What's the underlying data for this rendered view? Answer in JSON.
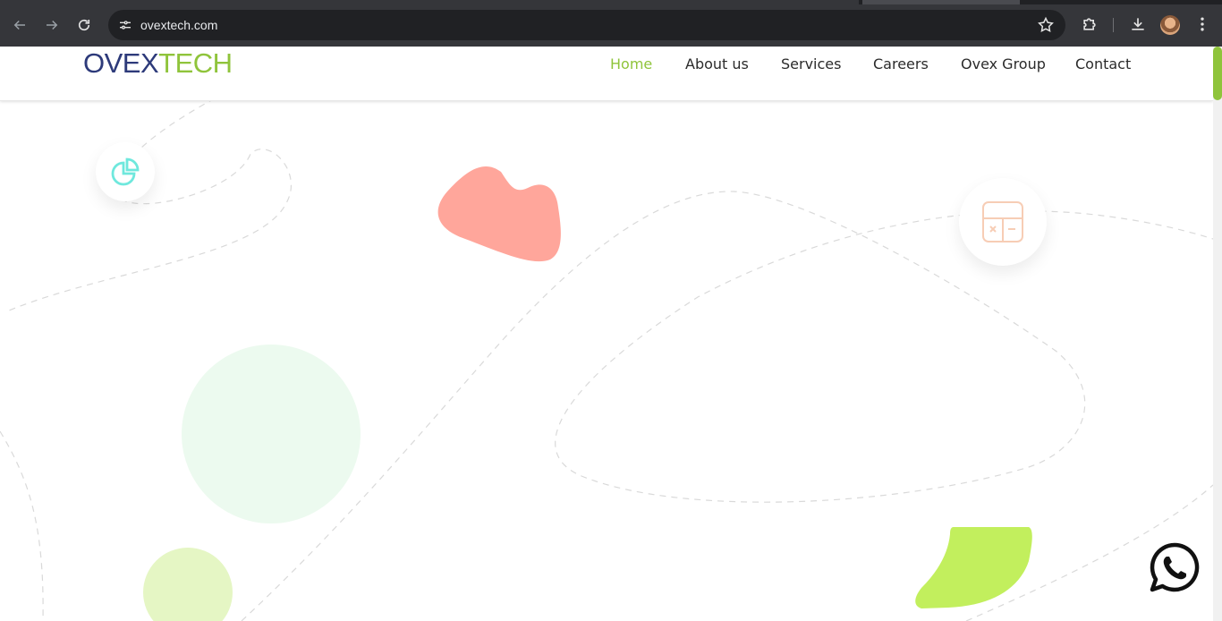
{
  "browser": {
    "url": "ovextech.com",
    "icons": {
      "back": "arrow-left-icon",
      "forward": "arrow-right-icon",
      "reload": "reload-icon",
      "site_info": "tune-icon",
      "bookmark": "star-icon",
      "extensions": "puzzle-icon",
      "download": "download-icon",
      "profile": "avatar",
      "menu": "kebab-menu-icon"
    }
  },
  "site": {
    "logo": {
      "part1": "OVEX",
      "part2": "TECH"
    },
    "nav": [
      {
        "label": "Home",
        "active": true
      },
      {
        "label": "About us",
        "active": false
      },
      {
        "label": "Services",
        "active": false
      },
      {
        "label": "Careers",
        "active": false
      },
      {
        "label": "Ovex Group",
        "active": false
      },
      {
        "label": "Contact",
        "active": false
      }
    ],
    "colors": {
      "brand_blue": "#2d3a7a",
      "brand_green": "#8fc43b",
      "salmon_blob": "#ffa69b",
      "lime_blob": "#c2ef5d",
      "mint_circle": "#ecfaef",
      "pale_lime_circle": "#e5f6c4",
      "chart_icon": "#6fe8dd",
      "calculator_icon": "#f7cdb5"
    },
    "floating_icons": [
      "pie-chart-icon",
      "calculator-icon",
      "whatsapp-icon"
    ]
  }
}
